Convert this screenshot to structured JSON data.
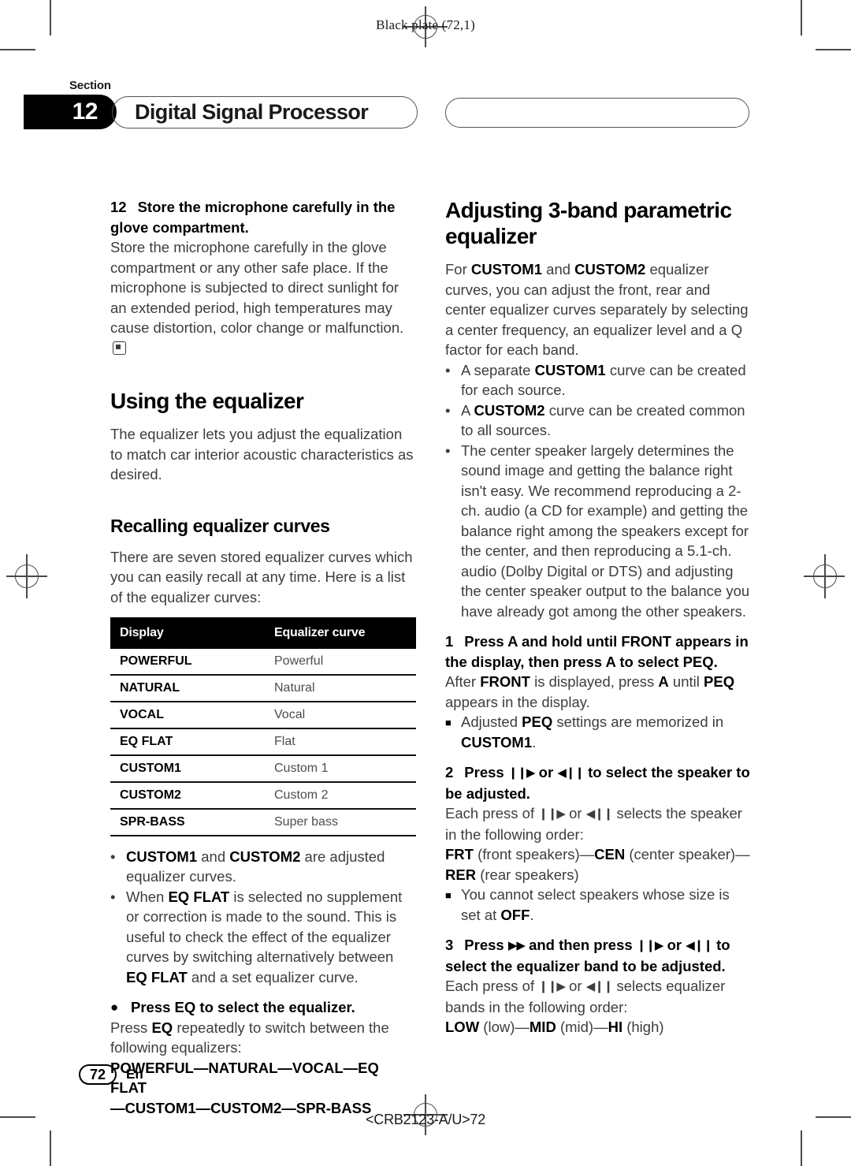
{
  "header": {
    "black_plate": "Black plate (72,1)",
    "section_word": "Section",
    "section_number": "12",
    "section_title": "Digital Signal Processor"
  },
  "left_column": {
    "item12_heading_num": "12",
    "item12_heading": "Store the microphone carefully in the glove compartment.",
    "item12_body": "Store the microphone carefully in the glove compartment or any other safe place. If the microphone is subjected to direct sunlight for an extended period, high temperatures may cause distortion, color change or malfunction.",
    "h1_using": "Using the equalizer",
    "using_body": "The equalizer lets you adjust the equalization to match car interior acoustic characteristics as desired.",
    "h2_recalling": "Recalling equalizer curves",
    "recalling_body": "There are seven stored equalizer curves which you can easily recall at any time. Here is a list of the equalizer curves:",
    "table": {
      "columns": [
        "Display",
        "Equalizer curve"
      ],
      "rows": [
        [
          "POWERFUL",
          "Powerful"
        ],
        [
          "NATURAL",
          "Natural"
        ],
        [
          "VOCAL",
          "Vocal"
        ],
        [
          "EQ FLAT",
          "Flat"
        ],
        [
          "CUSTOM1",
          "Custom 1"
        ],
        [
          "CUSTOM2",
          "Custom 2"
        ],
        [
          "SPR-BASS",
          "Super bass"
        ]
      ]
    },
    "bullet1_a": "CUSTOM1",
    "bullet1_b": "and",
    "bullet1_c": "CUSTOM2",
    "bullet1_d": "are adjusted equalizer curves.",
    "bullet2_a": "When",
    "bullet2_b": "EQ FLAT",
    "bullet2_c": "is selected no supplement or correction is made to the sound. This is useful to check the effect of the equalizer curves by switching alternatively between",
    "bullet2_d": "EQ FLAT",
    "bullet2_e": "and a set equalizer curve.",
    "press_eq_heading": "Press EQ to select the equalizer.",
    "press_eq_body_a": "Press",
    "press_eq_body_b": "EQ",
    "press_eq_body_c": "repeatedly to switch between the following equalizers:",
    "eq_chain_line1": "POWERFUL—NATURAL—VOCAL—EQ FLAT",
    "eq_chain_line2": "—CUSTOM1—CUSTOM2—SPR-BASS"
  },
  "right_column": {
    "h1_adjusting": "Adjusting 3-band parametric equalizer",
    "intro_a": "For",
    "intro_b": "CUSTOM1",
    "intro_c": "and",
    "intro_d": "CUSTOM2",
    "intro_e": "equalizer curves, you can adjust the front, rear and center equalizer curves separately by selecting a center frequency, an equalizer level and a Q factor for each band.",
    "bullet1_a": "A separate",
    "bullet1_b": "CUSTOM1",
    "bullet1_c": "curve can be created for each source.",
    "bullet2_a": "A",
    "bullet2_b": "CUSTOM2",
    "bullet2_c": "curve can be created common to all sources.",
    "bullet3": "The center speaker largely determines the sound image and getting the balance right isn't easy. We recommend reproducing a 2-ch. audio (a CD for example) and getting the balance right among the speakers except for the center, and then reproducing a 5.1-ch. audio (Dolby Digital or DTS) and adjusting the center speaker output to the balance you have already got among the other speakers.",
    "step1_num": "1",
    "step1_heading": "Press A and hold until FRONT appears in the display, then press A to select PEQ.",
    "step1_body_a": "After",
    "step1_body_b": "FRONT",
    "step1_body_c": "is displayed, press",
    "step1_body_d": "A",
    "step1_body_e": "until",
    "step1_body_f": "PEQ",
    "step1_body_g": "appears in the display.",
    "step1_note_a": "Adjusted",
    "step1_note_b": "PEQ",
    "step1_note_c": "settings are memorized in",
    "step1_note_d": "CUSTOM1",
    "step1_note_e": ".",
    "step2_num": "2",
    "step2_head_a": "Press",
    "step2_head_glyph1": "❙❙▶",
    "step2_head_b": "or",
    "step2_head_glyph2": "◀❙❙",
    "step2_head_c": "to select the speaker to be adjusted.",
    "step2_body_a": "Each press of",
    "step2_body_glyph1": "❙❙▶",
    "step2_body_b": "or",
    "step2_body_glyph2": "◀❙❙",
    "step2_body_c": "selects the speaker in the following order:",
    "step2_order_a": "FRT",
    "step2_order_b": "(front speakers)—",
    "step2_order_c": "CEN",
    "step2_order_d": "(center speaker)",
    "step2_order_e": "—",
    "step2_order_f": "RER",
    "step2_order_g": "(rear speakers)",
    "step2_note_a": "You cannot select speakers whose size is set at",
    "step2_note_b": "OFF",
    "step2_note_c": ".",
    "step3_num": "3",
    "step3_head_a": "Press",
    "step3_head_glyph0": "▶▶",
    "step3_head_b": "and then press",
    "step3_head_glyph1": "❙❙▶",
    "step3_head_c": "or",
    "step3_head_glyph2": "◀❙❙",
    "step3_head_d": "to select the equalizer band to be adjusted.",
    "step3_body_a": "Each press of",
    "step3_body_glyph1": "❙❙▶",
    "step3_body_b": "or",
    "step3_body_glyph2": "◀❙❙",
    "step3_body_c": "selects equalizer bands in the following order:",
    "step3_order_a": "LOW",
    "step3_order_b": "(low)—",
    "step3_order_c": "MID",
    "step3_order_d": "(mid)—",
    "step3_order_e": "HI",
    "step3_order_f": "(high)"
  },
  "footer": {
    "page_number": "72",
    "language": "En",
    "colophon": "<CRB2123-A/U>72"
  }
}
